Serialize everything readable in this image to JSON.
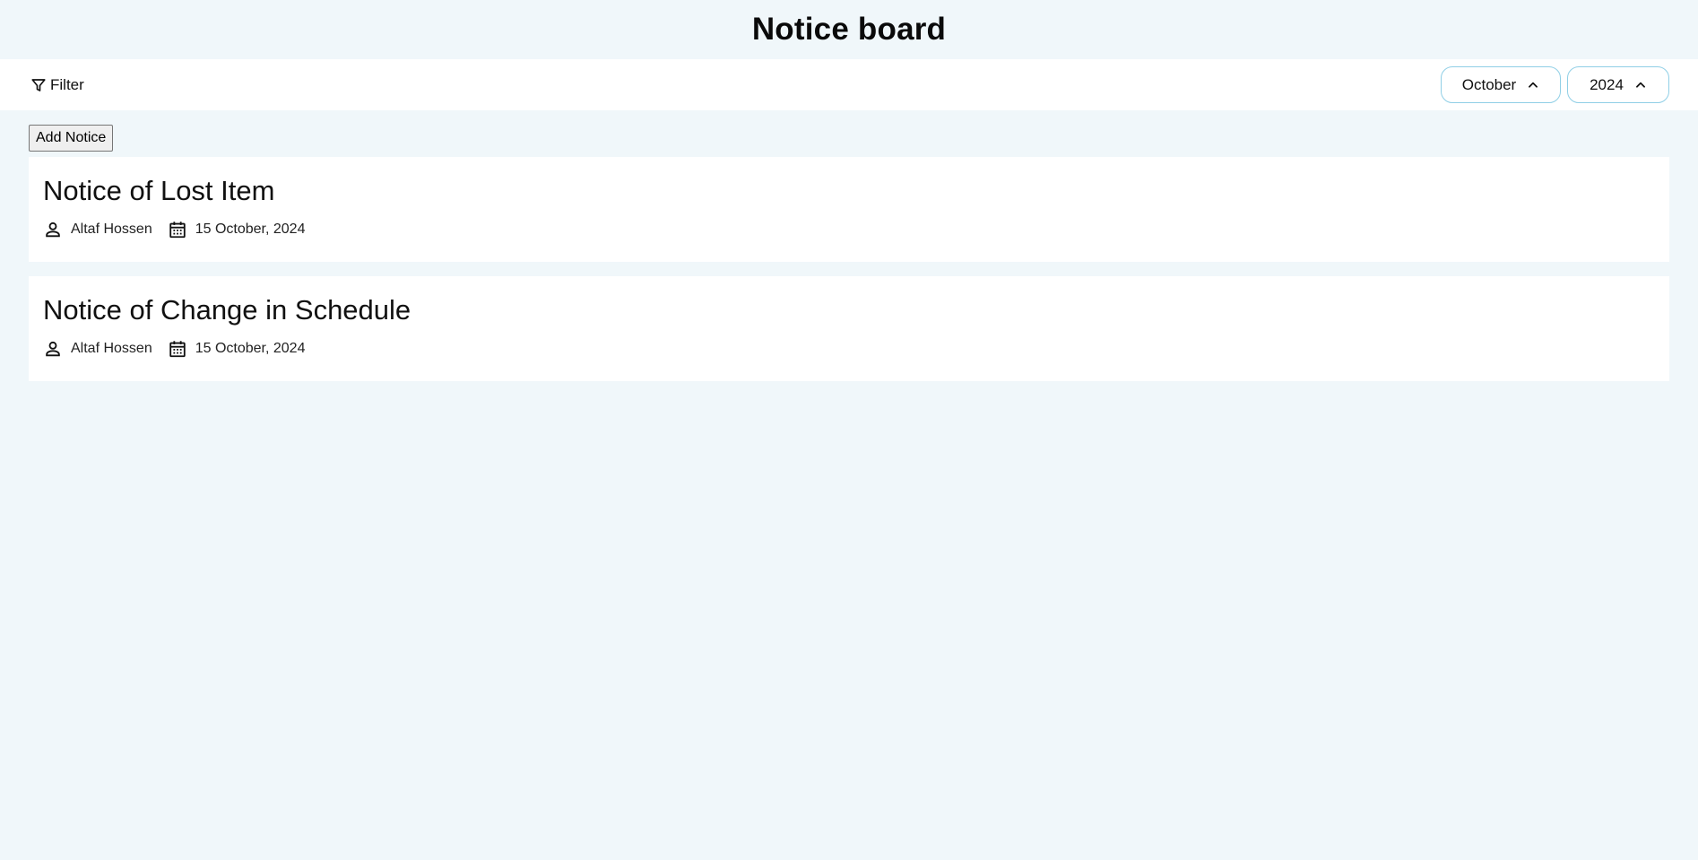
{
  "header": {
    "title": "Notice board"
  },
  "filter_bar": {
    "filter_label": "Filter",
    "filter_icon": "filter-icon",
    "month": {
      "value": "October",
      "icon": "chevron-up-icon"
    },
    "year": {
      "value": "2024",
      "icon": "chevron-up-icon"
    }
  },
  "actions": {
    "add_notice_label": "Add Notice"
  },
  "notices": [
    {
      "title": "Notice of Lost Item",
      "author": "Altaf Hossen",
      "date": "15 October, 2024",
      "author_icon": "person-icon",
      "date_icon": "calendar-icon"
    },
    {
      "title": "Notice of Change in Schedule",
      "author": "Altaf Hossen",
      "date": "15 October, 2024",
      "author_icon": "person-icon",
      "date_icon": "calendar-icon"
    }
  ],
  "colors": {
    "background": "#f0f7fa",
    "surface": "#ffffff",
    "pill_border": "#90cfe6"
  }
}
